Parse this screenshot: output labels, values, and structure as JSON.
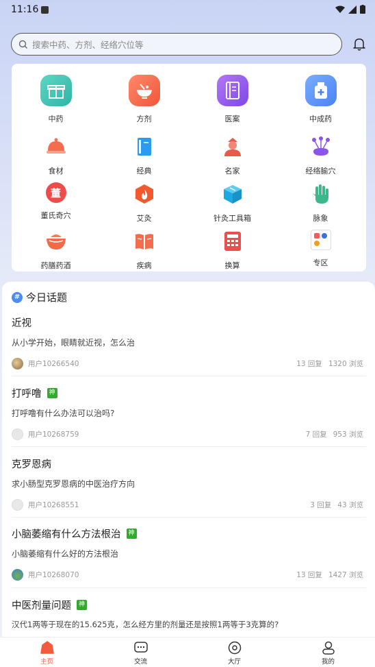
{
  "status_bar": {
    "time": "11:16"
  },
  "search": {
    "placeholder": "搜索中药、方剂、经络穴位等"
  },
  "grid": [
    {
      "label": "中药",
      "icon": "gift-box-icon"
    },
    {
      "label": "方剂",
      "icon": "medicine-bowl-icon"
    },
    {
      "label": "医案",
      "icon": "notebook-icon"
    },
    {
      "label": "中成药",
      "icon": "medicine-bottle-icon"
    },
    {
      "label": "食材",
      "icon": "food-cloche-icon"
    },
    {
      "label": "经典",
      "icon": "classic-book-icon"
    },
    {
      "label": "名家",
      "icon": "famous-doctor-icon"
    },
    {
      "label": "经络腧穴",
      "icon": "acupuncture-needles-icon"
    },
    {
      "label": "董氏奇穴",
      "icon": "dong-seal-icon",
      "glyph": "董"
    },
    {
      "label": "艾灸",
      "icon": "moxibustion-flame-icon"
    },
    {
      "label": "针灸工具箱",
      "icon": "toolbox-cube-icon"
    },
    {
      "label": "脉象",
      "icon": "pulse-hand-icon"
    },
    {
      "label": "药膳药酒",
      "icon": "herbal-bowl-icon"
    },
    {
      "label": "疾病",
      "icon": "open-book-icon"
    },
    {
      "label": "换算",
      "icon": "calculator-icon"
    },
    {
      "label": "专区",
      "icon": "special-zone-icon"
    }
  ],
  "topics": {
    "title": "今日话题",
    "items": [
      {
        "title": "近视",
        "badge": "",
        "desc": "从小学开始，眼睛就近视，怎么治",
        "user": "用户10266540",
        "replies": "13 回复",
        "views": "1320 浏览"
      },
      {
        "title": "打呼噜",
        "badge": "神",
        "desc": "打呼噜有什么办法可以治吗?",
        "user": "用户10268759",
        "replies": "7 回复",
        "views": "953 浏览"
      },
      {
        "title": "克罗恩病",
        "badge": "",
        "desc": "求小肠型克罗恩病的中医治疗方向",
        "user": "用户10268551",
        "replies": "3 回复",
        "views": "43 浏览"
      },
      {
        "title": "小脑萎缩有什么方法根治",
        "badge": "神",
        "desc": "小脑萎缩有什么好的方法根治",
        "user": "用户10268070",
        "replies": "13 回复",
        "views": "1427 浏览"
      },
      {
        "title": "中医剂量问题",
        "badge": "神",
        "desc": "汉代1两等于现在的15.625克，怎么经方里的剂量还是按照1两等于3克算的?",
        "user": "",
        "replies": "",
        "views": ""
      }
    ]
  },
  "nav": [
    {
      "label": "主页",
      "icon": "home-icon",
      "active": true
    },
    {
      "label": "交流",
      "icon": "chat-icon",
      "active": false
    },
    {
      "label": "大厅",
      "icon": "hall-icon",
      "active": false
    },
    {
      "label": "我的",
      "icon": "profile-icon",
      "active": false
    }
  ],
  "colors": {
    "accent": "#f25c3c",
    "badge": "#35a82f",
    "hash": "#4e8cf5"
  }
}
